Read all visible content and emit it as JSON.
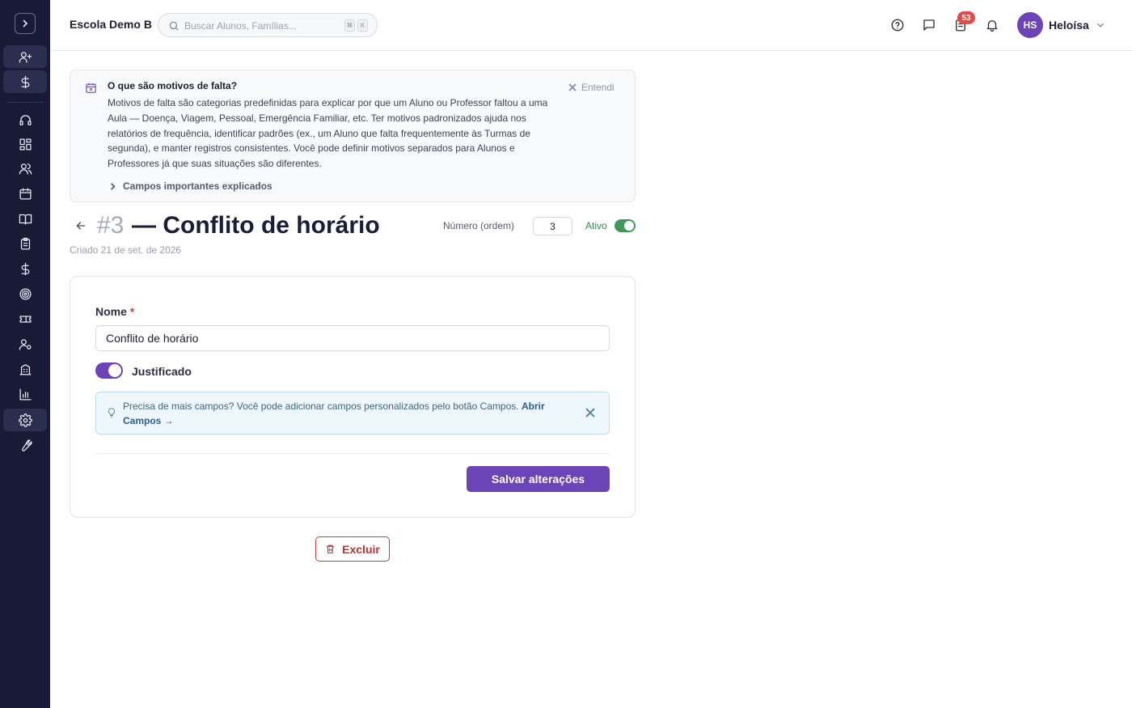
{
  "header": {
    "school_name": "Escola Demo B",
    "search_placeholder": "Buscar Alunos, Famílias...",
    "shortcut_keys": [
      "⌘",
      "K"
    ],
    "notification_count": "53",
    "user_initials": "HS",
    "user_name": "Heloísa"
  },
  "sidebar": {
    "items": [
      {
        "icon": "user-plus-icon"
      },
      {
        "icon": "dollar-icon"
      },
      {
        "icon": "headset-icon"
      },
      {
        "icon": "dashboard-icon"
      },
      {
        "icon": "users-icon"
      },
      {
        "icon": "calendar-icon"
      },
      {
        "icon": "book-icon"
      },
      {
        "icon": "clipboard-icon"
      },
      {
        "icon": "dollar-icon"
      },
      {
        "icon": "target-icon"
      },
      {
        "icon": "ticket-icon"
      },
      {
        "icon": "user-settings-icon"
      },
      {
        "icon": "building-icon"
      },
      {
        "icon": "bar-chart-icon"
      },
      {
        "icon": "gear-icon",
        "active": true
      },
      {
        "icon": "wrench-icon"
      }
    ]
  },
  "info": {
    "title": "O que são motivos de falta?",
    "body": "Motivos de falta são categorias predefinidas para explicar por que um Aluno ou Professor faltou a uma Aula — Doença, Viagem, Pessoal, Emergência Familiar, etc. Ter motivos padronizados ajuda nos relatórios de frequência, identificar padrões (ex., um Aluno que falta frequentemente às Turmas de segunda), e manter registros consistentes. Você pode definir motivos separados para Alunos e Professores já que suas situações são diferentes.",
    "dismiss_label": "Entendi",
    "fields_link": "Campos importantes explicados"
  },
  "page": {
    "number": "#3",
    "title": "— Conflito de horário",
    "created": "Criado 21 de set. de 2026",
    "order_label": "Número (ordem)",
    "order_value": "3",
    "active_label": "Ativo",
    "active": true
  },
  "form": {
    "name_label": "Nome",
    "required_mark": "*",
    "name_value": "Conflito de horário",
    "justified_label": "Justificado",
    "justified": true,
    "tip_text": "Precisa de mais campos? Você pode adicionar campos personalizados pelo botão Campos.",
    "tip_link": "Abrir Campos →",
    "save_label": "Salvar alterações",
    "delete_label": "Excluir"
  },
  "colors": {
    "primary": "#6b44b7",
    "sidebar": "#191a36",
    "success": "#3f9a5a",
    "danger": "#d33b3b"
  }
}
